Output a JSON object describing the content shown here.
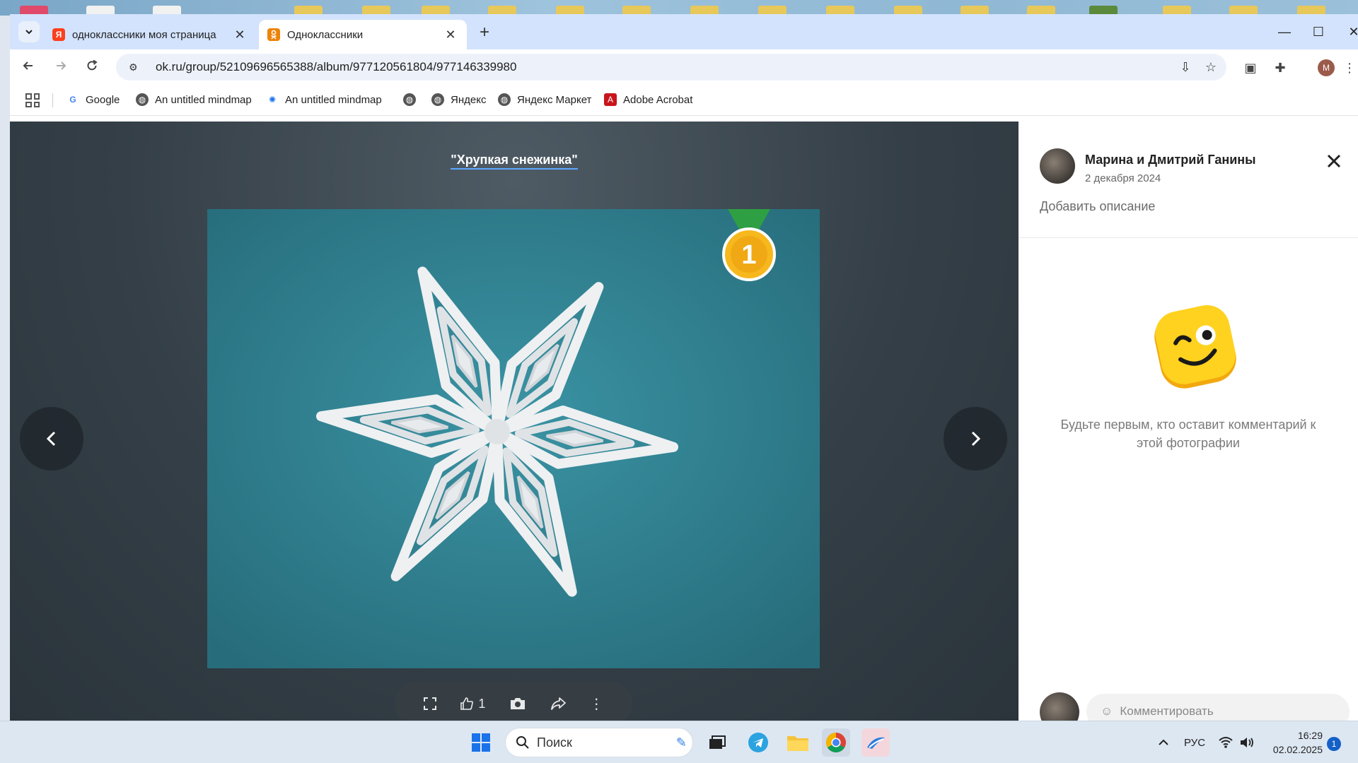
{
  "browser": {
    "tabs": [
      {
        "title": "одноклассники моя страница",
        "favicon": "yandex-icon",
        "active": false
      },
      {
        "title": "Одноклассники",
        "favicon": "ok-icon",
        "active": true
      }
    ],
    "url": "ok.ru/group/52109696565388/album/977120561804/977146339980",
    "profile_initial": "M",
    "bookmarks": [
      {
        "label": "Google",
        "icon": "google-icon"
      },
      {
        "label": "An untitled mindmap",
        "icon": "globe-icon"
      },
      {
        "label": "An untitled mindmap",
        "icon": "mindmap-icon"
      },
      {
        "label": "",
        "icon": "globe-icon"
      },
      {
        "label": "Яндекс",
        "icon": "globe-icon"
      },
      {
        "label": "Яндекс Маркет",
        "icon": "globe-icon"
      },
      {
        "label": "Adobe Acrobat",
        "icon": "acrobat-icon"
      }
    ]
  },
  "viewer": {
    "album_title": "\"Хрупкая снежинка\"",
    "likes": "1",
    "medal_number": "1"
  },
  "panel": {
    "author": "Марина и Дмитрий Ганины",
    "date": "2 декабря 2024",
    "add_description": "Добавить описание",
    "empty_comments": "Будьте первым, кто оставит комментарий к этой фотографии",
    "comment_placeholder": "Комментировать"
  },
  "taskbar": {
    "search_label": "Поиск",
    "language": "РУС",
    "time": "16:29",
    "date": "02.02.2025",
    "notifications": "1"
  },
  "colors": {
    "tabstrip": "#d3e3fd",
    "viewer_bg": "#343f47",
    "photo_bg": "#2f7e8e",
    "accent_link": "#5ea8ff",
    "medal_gold": "#f6b81c",
    "ribbon_green": "#2ea043"
  }
}
